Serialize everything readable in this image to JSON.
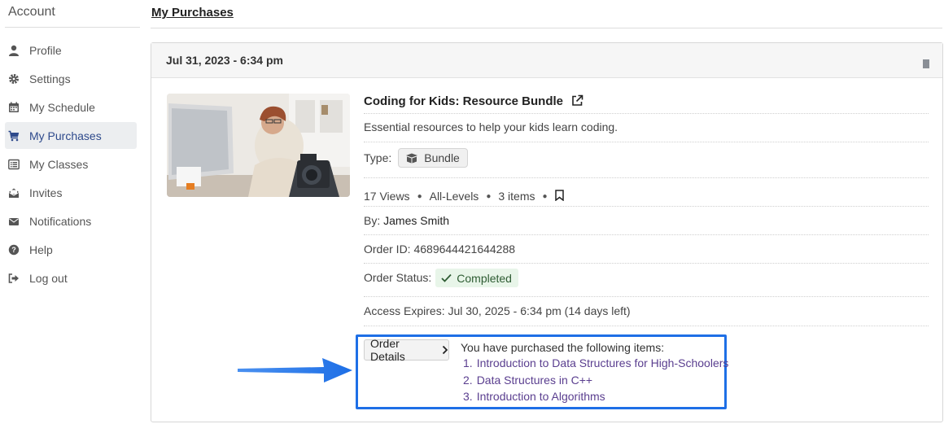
{
  "sidebar": {
    "title": "Account",
    "items": [
      {
        "label": "Profile",
        "icon": "user-icon"
      },
      {
        "label": "Settings",
        "icon": "gear-icon"
      },
      {
        "label": "My Schedule",
        "icon": "calendar-icon"
      },
      {
        "label": "My Purchases",
        "icon": "cart-icon",
        "active": true
      },
      {
        "label": "My Classes",
        "icon": "list-icon"
      },
      {
        "label": "Invites",
        "icon": "envelope-open-icon"
      },
      {
        "label": "Notifications",
        "icon": "envelope-icon"
      },
      {
        "label": "Help",
        "icon": "help-icon"
      },
      {
        "label": "Log out",
        "icon": "logout-icon"
      }
    ]
  },
  "header": {
    "title": "My Purchases"
  },
  "purchase": {
    "date": "Jul 31, 2023 - 6:34 pm",
    "title": "Coding for Kids: Resource Bundle",
    "description": "Essential resources to help your kids learn coding.",
    "type_label": "Type:",
    "type_value": "Bundle",
    "views": "17 Views",
    "level": "All-Levels",
    "items_count": "3 items",
    "by_label": "By:",
    "author": "James Smith",
    "order_id": "Order ID: 4689644421644288",
    "status_label": "Order Status:",
    "status_value": "Completed",
    "expires": "Access Expires: Jul 30, 2025 - 6:34 pm (14 days left)",
    "order_details_label": "Order Details",
    "items_intro": "You have purchased the following items:",
    "items": [
      "Introduction to Data Structures for High-Schoolers",
      "Data Structures in C++",
      "Introduction to Algorithms"
    ]
  },
  "colors": {
    "accent": "#2e4a8c",
    "highlight": "#1e6fe6",
    "link": "#5a3e8f",
    "status_bg": "#e8f5e9"
  }
}
